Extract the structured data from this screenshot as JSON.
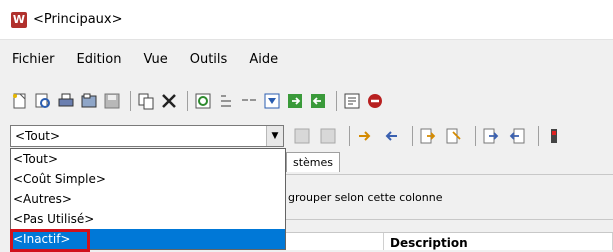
{
  "window": {
    "title": "<Principaux>",
    "app_icon_glyph": "W"
  },
  "menu": [
    "Fichier",
    "Edition",
    "Vue",
    "Outils",
    "Aide"
  ],
  "filter_combo": {
    "value": "<Tout>"
  },
  "dropdown_items": [
    "<Tout>",
    "<Coût Simple>",
    "<Autres>",
    "<Pas Utilisé>",
    "<Inactif>"
  ],
  "selected_item_index": 4,
  "tab": {
    "label": "stèmes"
  },
  "group_panel": {
    "text": "grouper selon cette colonne"
  },
  "columns": {
    "description": "Description"
  },
  "colors": {
    "selection": "#0078d7",
    "highlight_border": "#d0121b",
    "app_icon": "#b0302c"
  }
}
